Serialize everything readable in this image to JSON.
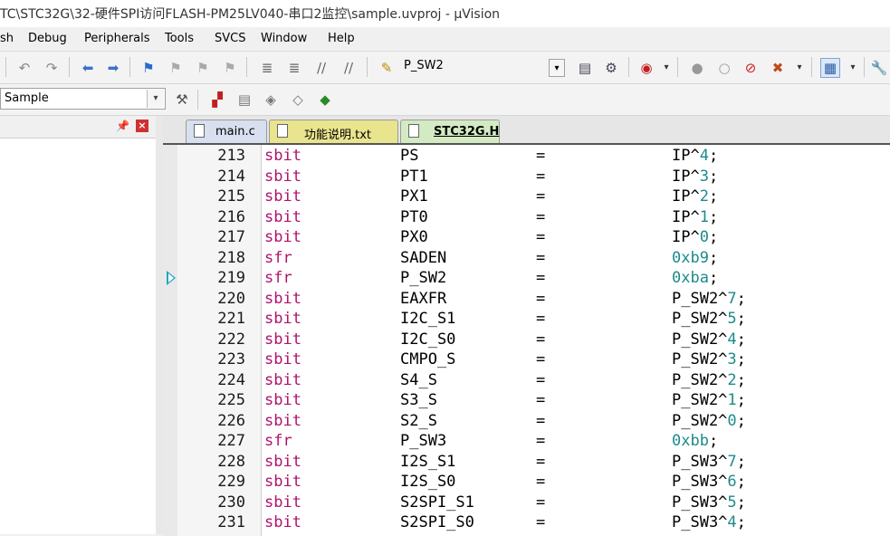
{
  "window": {
    "title": "TC\\STC32G\\32-硬件SPI访问FLASH-PM25LV040-串口2监控\\sample.uvproj - µVision"
  },
  "menu": [
    "sh",
    "Debug",
    "Peripherals",
    "Tools",
    "SVCS",
    "Window",
    "Help"
  ],
  "toolbar": {
    "find_value": "P_SW2",
    "target_value": "Sample"
  },
  "tabs": [
    {
      "label": "main.c",
      "active": false
    },
    {
      "label": "功能说明.txt",
      "active": false
    },
    {
      "label": "STC32G.H",
      "active": true
    }
  ],
  "code": [
    {
      "ln": "213",
      "kw": "sbit",
      "name": "PS",
      "eq": "=",
      "val": "IP^",
      "num": "4",
      "end": ";"
    },
    {
      "ln": "214",
      "kw": "sbit",
      "name": "PT1",
      "eq": "=",
      "val": "IP^",
      "num": "3",
      "end": ";"
    },
    {
      "ln": "215",
      "kw": "sbit",
      "name": "PX1",
      "eq": "=",
      "val": "IP^",
      "num": "2",
      "end": ";"
    },
    {
      "ln": "216",
      "kw": "sbit",
      "name": "PT0",
      "eq": "=",
      "val": "IP^",
      "num": "1",
      "end": ";"
    },
    {
      "ln": "217",
      "kw": "sbit",
      "name": "PX0",
      "eq": "=",
      "val": "IP^",
      "num": "0",
      "end": ";"
    },
    {
      "ln": "218",
      "kw": "sfr",
      "name": "SADEN",
      "eq": "=",
      "val": "",
      "num": "0xb9",
      "end": ";"
    },
    {
      "ln": "219",
      "kw": "sfr",
      "name": "P_SW2",
      "eq": "=",
      "val": "",
      "num": "0xba",
      "end": ";"
    },
    {
      "ln": "220",
      "kw": "sbit",
      "name": "EAXFR",
      "eq": "=",
      "val": "P_SW2^",
      "num": "7",
      "end": ";"
    },
    {
      "ln": "221",
      "kw": "sbit",
      "name": "I2C_S1",
      "eq": "=",
      "val": "P_SW2^",
      "num": "5",
      "end": ";"
    },
    {
      "ln": "222",
      "kw": "sbit",
      "name": "I2C_S0",
      "eq": "=",
      "val": "P_SW2^",
      "num": "4",
      "end": ";"
    },
    {
      "ln": "223",
      "kw": "sbit",
      "name": "CMPO_S",
      "eq": "=",
      "val": "P_SW2^",
      "num": "3",
      "end": ";"
    },
    {
      "ln": "224",
      "kw": "sbit",
      "name": "S4_S",
      "eq": "=",
      "val": "P_SW2^",
      "num": "2",
      "end": ";"
    },
    {
      "ln": "225",
      "kw": "sbit",
      "name": "S3_S",
      "eq": "=",
      "val": "P_SW2^",
      "num": "1",
      "end": ";"
    },
    {
      "ln": "226",
      "kw": "sbit",
      "name": "S2_S",
      "eq": "=",
      "val": "P_SW2^",
      "num": "0",
      "end": ";"
    },
    {
      "ln": "227",
      "kw": "sfr",
      "name": "P_SW3",
      "eq": "=",
      "val": "",
      "num": "0xbb",
      "end": ";"
    },
    {
      "ln": "228",
      "kw": "sbit",
      "name": "I2S_S1",
      "eq": "=",
      "val": "P_SW3^",
      "num": "7",
      "end": ";"
    },
    {
      "ln": "229",
      "kw": "sbit",
      "name": "I2S_S0",
      "eq": "=",
      "val": "P_SW3^",
      "num": "6",
      "end": ";"
    },
    {
      "ln": "230",
      "kw": "sbit",
      "name": "S2SPI_S1",
      "eq": "=",
      "val": "P_SW3^",
      "num": "5",
      "end": ";"
    },
    {
      "ln": "231",
      "kw": "sbit",
      "name": "S2SPI_S0",
      "eq": "=",
      "val": "P_SW3^",
      "num": "4",
      "end": ";"
    }
  ]
}
